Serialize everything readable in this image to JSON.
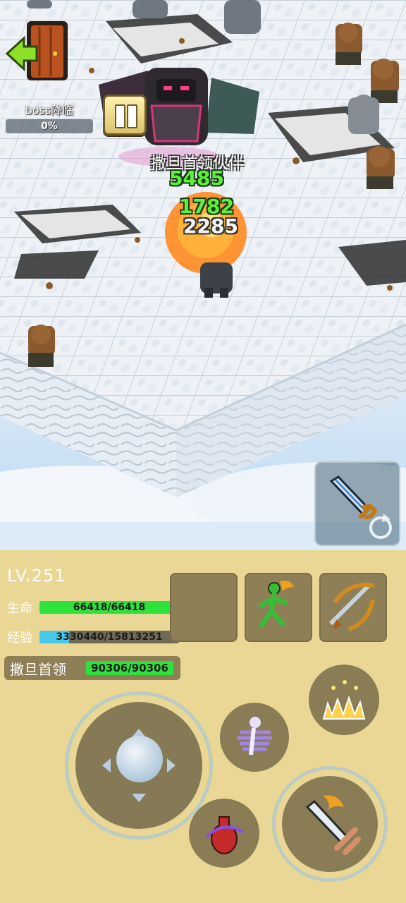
{
  "hud": {
    "exit_icon": "exit-door-icon",
    "boss_progress": {
      "label": "boss降临",
      "percent_text": "0%",
      "value": 0
    },
    "pause_icon": "pause-icon"
  },
  "battle": {
    "boss_name": "撒旦首领伙伴",
    "damage_numbers": [
      "5485",
      "1782",
      "2285"
    ]
  },
  "weapon_swap_icon": "sword-swap-icon",
  "player": {
    "level": "LV.251",
    "hp": {
      "label": "生命",
      "text": "66418/66418",
      "value": 66418,
      "max": 66418
    },
    "xp": {
      "label": "经验",
      "text": "3330440/15813251",
      "value": 3330440,
      "max": 15813251
    }
  },
  "boss_status": {
    "name": "撒旦首领",
    "text": "90306/90306",
    "value": 90306,
    "max": 90306
  },
  "slots": [
    "empty-slot",
    "green-runner-icon",
    "crossbow-icon"
  ],
  "skills": [
    "spike-burst-icon",
    "ghost-dash-icon",
    "potion-icon",
    "sword-attack-icon"
  ],
  "colors": {
    "hp": "#2de23a",
    "xp": "#47c7ea",
    "panel": "#ead795",
    "joystick": "#857a55"
  }
}
